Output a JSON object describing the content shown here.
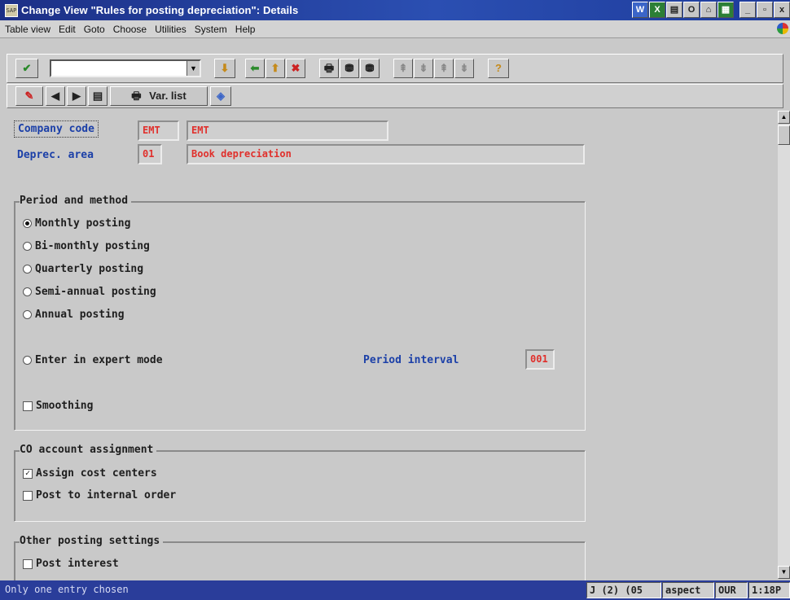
{
  "window": {
    "title": "Change View \"Rules for posting depreciation\": Details",
    "tray_icons": [
      "W",
      "X",
      "▤",
      "O",
      "⌂",
      "▦"
    ],
    "controls": [
      "_",
      "▫",
      "x"
    ]
  },
  "menu": [
    "Table view",
    "Edit",
    "Goto",
    "Choose",
    "Utilities",
    "System",
    "Help"
  ],
  "toolbar_standard": {
    "command_field": "",
    "buttons": [
      "✔",
      "⬅",
      "⬆",
      "✖",
      "🖶",
      "⛃",
      "⛃",
      "⇞",
      "⇟",
      "⇞",
      "⇟",
      "?"
    ]
  },
  "toolbar_app": {
    "buttons": [
      "✎",
      "◀",
      "▶",
      "▤",
      "🖶"
    ],
    "var_list_label": "Var. list",
    "extra_icon": "◈"
  },
  "fields": {
    "company_code": {
      "label": "Company code",
      "value": "EMT",
      "description": "EMT"
    },
    "deprec_area": {
      "label": "Deprec. area",
      "value": "01",
      "description": "Book depreciation"
    }
  },
  "period_method": {
    "title": "Period and method",
    "options": [
      "Monthly posting",
      "Bi-monthly posting",
      "Quarterly posting",
      "Semi-annual posting",
      "Annual posting",
      "Enter in expert mode"
    ],
    "selected_index": 0,
    "period_interval_label": "Period interval",
    "period_interval_value": "001",
    "smoothing_label": "Smoothing",
    "smoothing_checked": false
  },
  "co_assignment": {
    "title": "CO account assignment",
    "assign_cost_centers": "Assign cost centers",
    "assign_cost_centers_checked": true,
    "post_internal_order": "Post to internal order",
    "post_internal_order_checked": false
  },
  "other_posting": {
    "title": "Other posting settings",
    "post_interest": "Post interest",
    "post_interest_checked": false
  },
  "status": {
    "message": "Only one entry chosen",
    "cells": [
      "J (2) (05",
      "aspect",
      "OUR",
      "1:18P"
    ]
  },
  "colors": {
    "titlebar": "#2b4fb2",
    "label_blue": "#1c40a8",
    "value_red": "#e0302c",
    "statusbar": "#2a3d9a"
  }
}
